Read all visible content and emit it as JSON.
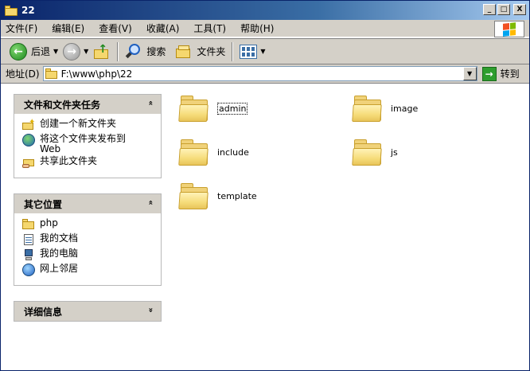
{
  "window": {
    "title": "22",
    "buttons": {
      "minimize": "_",
      "maximize": "□",
      "close": "X"
    }
  },
  "menu": [
    "文件(F)",
    "编辑(E)",
    "查看(V)",
    "收藏(A)",
    "工具(T)",
    "帮助(H)"
  ],
  "toolbar": {
    "back_label": "后退",
    "back_glyph": "←",
    "forward_glyph": "→",
    "dropdown_glyph": "▼",
    "up_glyph": "↑",
    "search_label": "搜索",
    "folders_label": "文件夹"
  },
  "address": {
    "label": "地址(D)",
    "path": "F:\\www\\php\\22",
    "dropdown_glyph": "▼",
    "go_glyph": "→",
    "go_label": "转到"
  },
  "taskpane": {
    "file_tasks": {
      "title": "文件和文件夹任务",
      "collapse_glyph": "«",
      "items": [
        {
          "label": "创建一个新文件夹"
        },
        {
          "label": "将这个文件夹发布到 Web"
        },
        {
          "label": "共享此文件夹"
        }
      ]
    },
    "other_places": {
      "title": "其它位置",
      "collapse_glyph": "«",
      "items": [
        {
          "label": "php"
        },
        {
          "label": "我的文档"
        },
        {
          "label": "我的电脑"
        },
        {
          "label": "网上邻居"
        }
      ]
    },
    "details": {
      "title": "详细信息",
      "expand_glyph": "»"
    }
  },
  "folders": [
    {
      "name": "admin",
      "selected": true
    },
    {
      "name": "image",
      "selected": false
    },
    {
      "name": "include",
      "selected": false
    },
    {
      "name": "js",
      "selected": false
    },
    {
      "name": "template",
      "selected": false
    }
  ],
  "colors": {
    "titlebar_start": "#0a246a",
    "titlebar_end": "#a6caf0",
    "chrome": "#d4d0c8",
    "folder": "#f6dc7a"
  }
}
